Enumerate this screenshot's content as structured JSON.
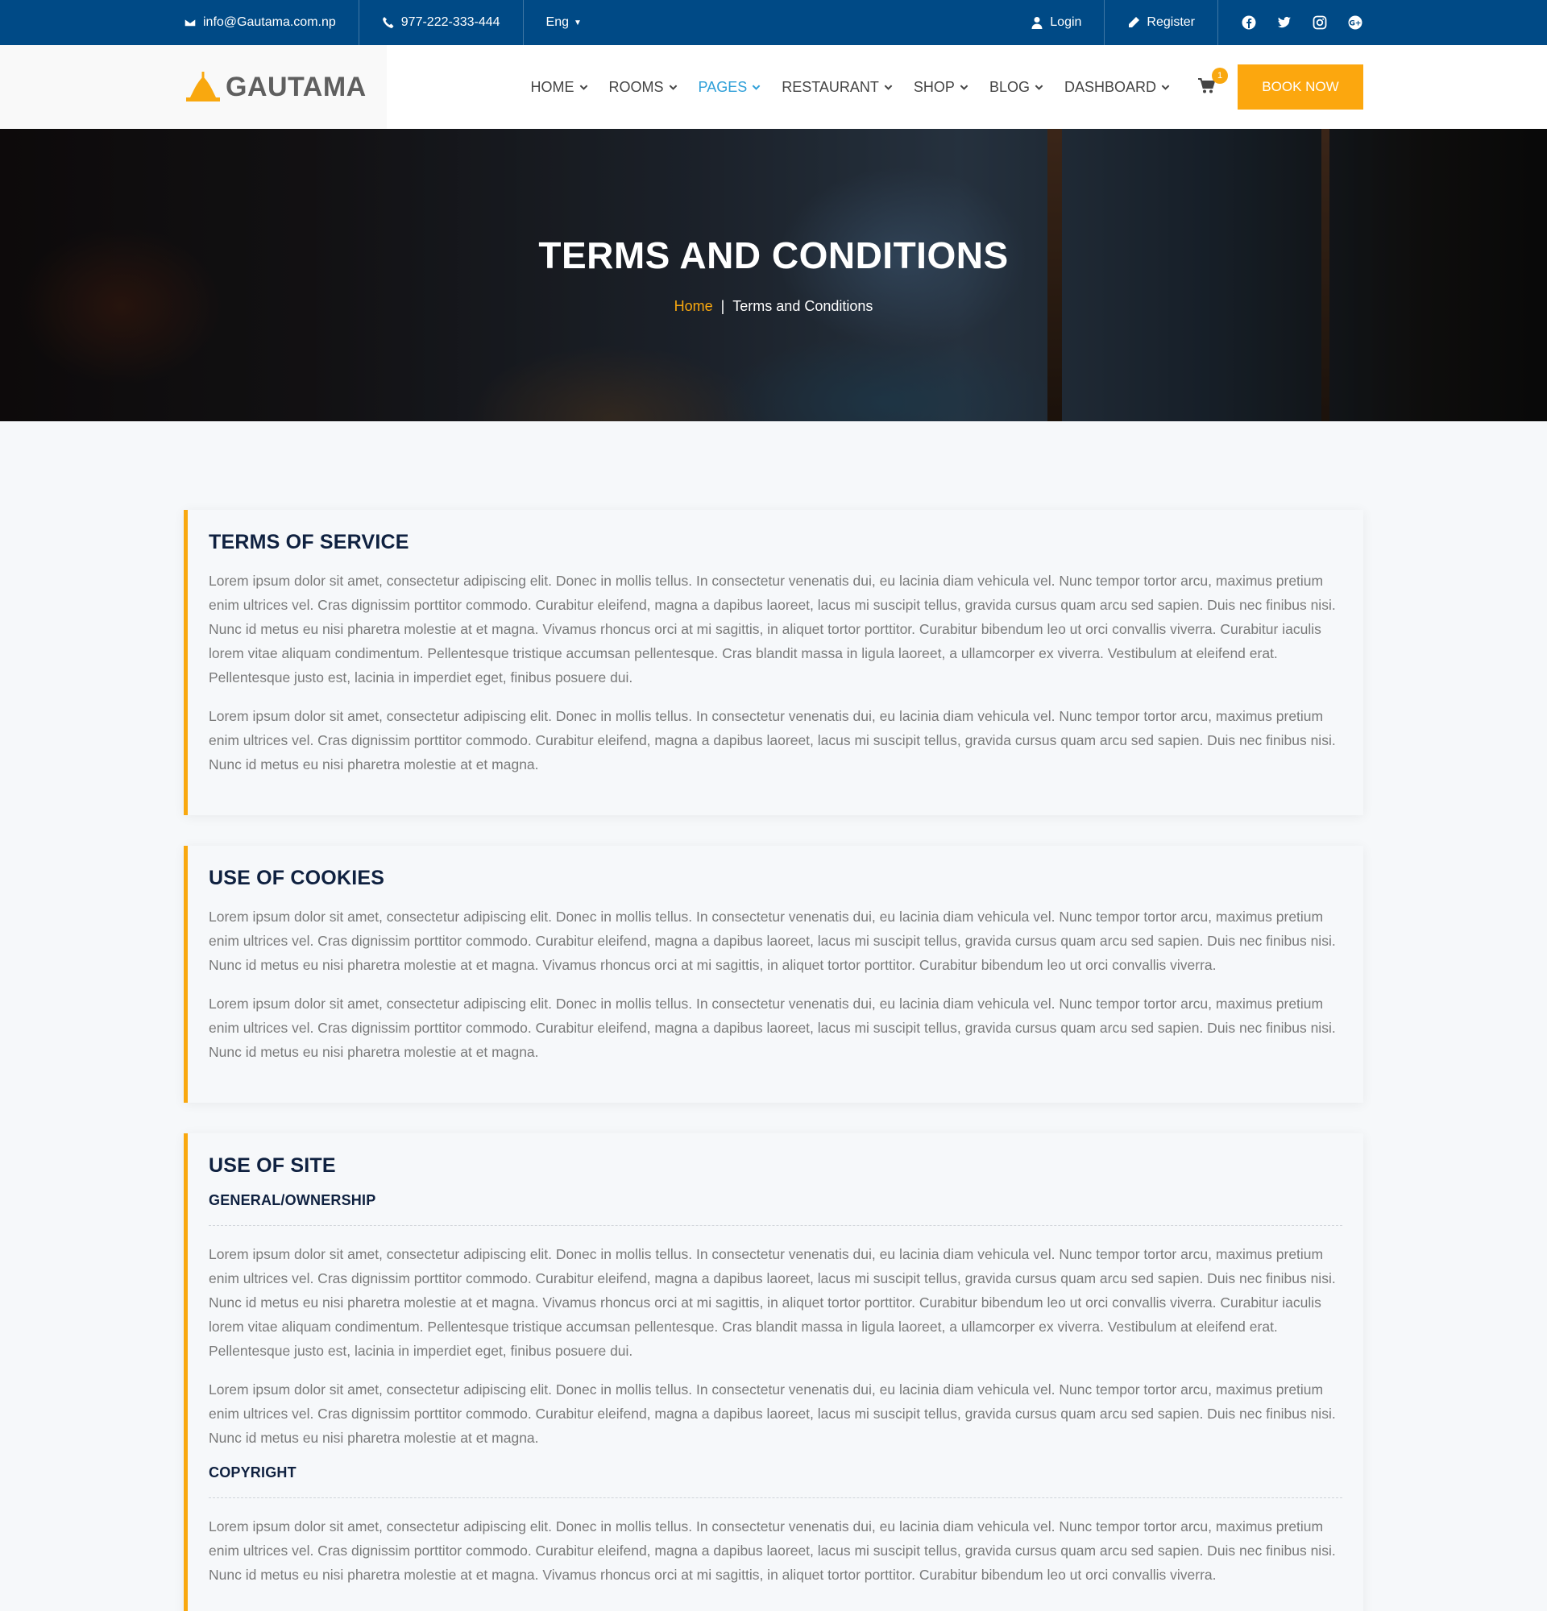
{
  "topbar": {
    "email": "info@Gautama.com.np",
    "phone": "977-222-333-444",
    "language": "Eng",
    "login": "Login",
    "register": "Register",
    "social_icons": [
      "facebook-icon",
      "twitter-icon",
      "instagram-icon",
      "google-plus-icon"
    ]
  },
  "header": {
    "logo_text": "GAUTAMA",
    "nav": [
      {
        "label": "HOME",
        "active": false
      },
      {
        "label": "ROOMS",
        "active": false
      },
      {
        "label": "PAGES",
        "active": true
      },
      {
        "label": "RESTAURANT",
        "active": false
      },
      {
        "label": "SHOP",
        "active": false
      },
      {
        "label": "BLOG",
        "active": false
      },
      {
        "label": "DASHBOARD",
        "active": false
      }
    ],
    "cart_count": "1",
    "book_button": "BOOK NOW"
  },
  "hero": {
    "title": "TERMS AND CONDITIONS",
    "breadcrumb_home": "Home",
    "breadcrumb_separator": "|",
    "breadcrumb_current": "Terms and Conditions"
  },
  "sections": {
    "terms": {
      "title": "TERMS OF SERVICE",
      "p1": "Lorem ipsum dolor sit amet, consectetur adipiscing elit. Donec in mollis tellus. In consectetur venenatis dui, eu lacinia diam vehicula vel. Nunc tempor tortor arcu, maximus pretium enim ultrices vel. Cras dignissim porttitor commodo. Curabitur eleifend, magna a dapibus laoreet, lacus mi suscipit tellus, gravida cursus quam arcu sed sapien. Duis nec finibus nisi. Nunc id metus eu nisi pharetra molestie at et magna. Vivamus rhoncus orci at mi sagittis, in aliquet tortor porttitor. Curabitur bibendum leo ut orci convallis viverra. Curabitur iaculis lorem vitae aliquam condimentum. Pellentesque tristique accumsan pellentesque. Cras blandit massa in ligula laoreet, a ullamcorper ex viverra. Vestibulum at eleifend erat. Pellentesque justo est, lacinia in imperdiet eget, finibus posuere dui.",
      "p2": "Lorem ipsum dolor sit amet, consectetur adipiscing elit. Donec in mollis tellus. In consectetur venenatis dui, eu lacinia diam vehicula vel. Nunc tempor tortor arcu, maximus pretium enim ultrices vel. Cras dignissim porttitor commodo. Curabitur eleifend, magna a dapibus laoreet, lacus mi suscipit tellus, gravida cursus quam arcu sed sapien. Duis nec finibus nisi. Nunc id metus eu nisi pharetra molestie at et magna."
    },
    "cookies": {
      "title": "USE OF COOKIES",
      "p1": "Lorem ipsum dolor sit amet, consectetur adipiscing elit. Donec in mollis tellus. In consectetur venenatis dui, eu lacinia diam vehicula vel. Nunc tempor tortor arcu, maximus pretium enim ultrices vel. Cras dignissim porttitor commodo. Curabitur eleifend, magna a dapibus laoreet, lacus mi suscipit tellus, gravida cursus quam arcu sed sapien. Duis nec finibus nisi. Nunc id metus eu nisi pharetra molestie at et magna. Vivamus rhoncus orci at mi sagittis, in aliquet tortor porttitor. Curabitur bibendum leo ut orci convallis viverra.",
      "p2": "Lorem ipsum dolor sit amet, consectetur adipiscing elit. Donec in mollis tellus. In consectetur venenatis dui, eu lacinia diam vehicula vel. Nunc tempor tortor arcu, maximus pretium enim ultrices vel. Cras dignissim porttitor commodo. Curabitur eleifend, magna a dapibus laoreet, lacus mi suscipit tellus, gravida cursus quam arcu sed sapien. Duis nec finibus nisi. Nunc id metus eu nisi pharetra molestie at et magna."
    },
    "site": {
      "title": "USE OF SITE",
      "sub1": "GENERAL/OWNERSHIP",
      "p1": "Lorem ipsum dolor sit amet, consectetur adipiscing elit. Donec in mollis tellus. In consectetur venenatis dui, eu lacinia diam vehicula vel. Nunc tempor tortor arcu, maximus pretium enim ultrices vel. Cras dignissim porttitor commodo. Curabitur eleifend, magna a dapibus laoreet, lacus mi suscipit tellus, gravida cursus quam arcu sed sapien. Duis nec finibus nisi. Nunc id metus eu nisi pharetra molestie at et magna. Vivamus rhoncus orci at mi sagittis, in aliquet tortor porttitor. Curabitur bibendum leo ut orci convallis viverra. Curabitur iaculis lorem vitae aliquam condimentum. Pellentesque tristique accumsan pellentesque. Cras blandit massa in ligula laoreet, a ullamcorper ex viverra. Vestibulum at eleifend erat. Pellentesque justo est, lacinia in imperdiet eget, finibus posuere dui.",
      "p2": "Lorem ipsum dolor sit amet, consectetur adipiscing elit. Donec in mollis tellus. In consectetur venenatis dui, eu lacinia diam vehicula vel. Nunc tempor tortor arcu, maximus pretium enim ultrices vel. Cras dignissim porttitor commodo. Curabitur eleifend, magna a dapibus laoreet, lacus mi suscipit tellus, gravida cursus quam arcu sed sapien. Duis nec finibus nisi. Nunc id metus eu nisi pharetra molestie at et magna.",
      "sub2": "COPYRIGHT",
      "p3": "Lorem ipsum dolor sit amet, consectetur adipiscing elit. Donec in mollis tellus. In consectetur venenatis dui, eu lacinia diam vehicula vel. Nunc tempor tortor arcu, maximus pretium enim ultrices vel. Cras dignissim porttitor commodo. Curabitur eleifend, magna a dapibus laoreet, lacus mi suscipit tellus, gravida cursus quam arcu sed sapien. Duis nec finibus nisi. Nunc id metus eu nisi pharetra molestie at et magna. Vivamus rhoncus orci at mi sagittis, in aliquet tortor porttitor. Curabitur bibendum leo ut orci convallis viverra."
    }
  },
  "colors": {
    "topbar": "#004a86",
    "accent": "#f9a80f",
    "nav_active": "#2e9fd8",
    "heading": "#0f2140"
  }
}
